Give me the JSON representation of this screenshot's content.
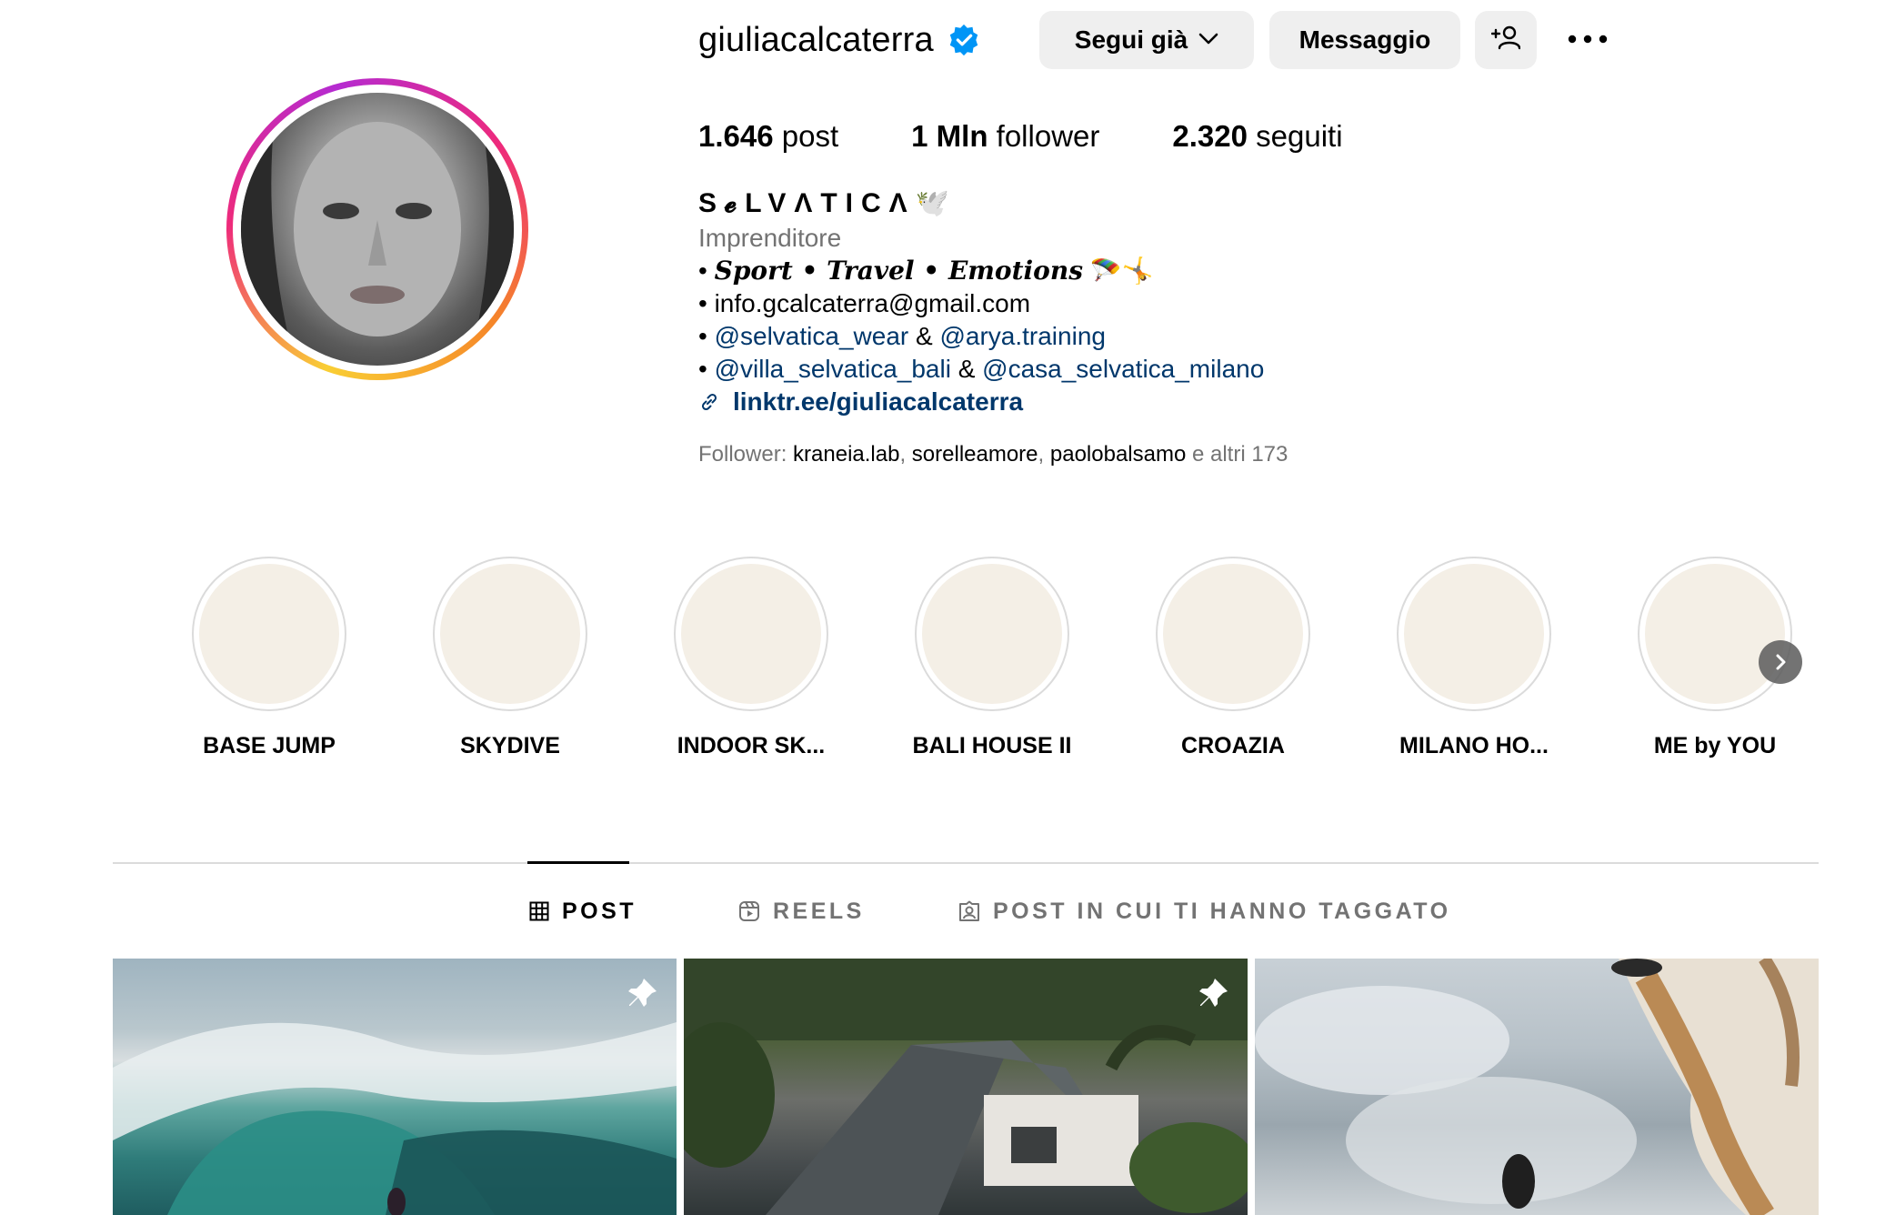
{
  "profile": {
    "username": "giuliacalcaterra",
    "verified": true,
    "buttons": {
      "follow": "Segui già",
      "message": "Messaggio"
    },
    "stats": {
      "posts_value": "1.646",
      "posts_label": "post",
      "followers_value": "1 Mln",
      "followers_label": "follower",
      "following_value": "2.320",
      "following_label": "seguiti"
    },
    "bio": {
      "name": "S𝓮LVΛTICΛ🕊️",
      "category": "Imprenditore",
      "line1_prefix": "• ",
      "line1_text": "Sport • Travel • Emotions",
      "line1_emoji": "🪂🤸",
      "line2": "• info.gcalcaterra@gmail.com",
      "line3_prefix": "• ",
      "line3_mention1": "@selvatica_wear",
      "line3_sep": " & ",
      "line3_mention2": "@arya.training",
      "line4_prefix": "• ",
      "line4_mention1": "@villa_selvatica_bali",
      "line4_sep": " & ",
      "line4_mention2": "@casa_selvatica_milano",
      "link": "linktr.ee/giuliacalcaterra"
    },
    "followed_by": {
      "label": "Follower: ",
      "users": [
        "kraneia.lab",
        "sorelleamore",
        "paolobalsamo"
      ],
      "comma": ", ",
      "suffix": " e altri 173"
    }
  },
  "highlights": [
    {
      "label": "BASE JUMP"
    },
    {
      "label": "SKYDIVE"
    },
    {
      "label": "INDOOR SK..."
    },
    {
      "label": "BALI HOUSE II"
    },
    {
      "label": "CROAZIA"
    },
    {
      "label": "MILANO HO..."
    },
    {
      "label": "ME by YOU"
    }
  ],
  "tabs": [
    {
      "label": "POST",
      "active": true
    },
    {
      "label": "REELS",
      "active": false
    },
    {
      "label": "POST IN CUI TI HANNO TAGGATO",
      "active": false
    }
  ],
  "posts": [
    {
      "pinned": true
    },
    {
      "pinned": true
    },
    {
      "pinned": false
    }
  ],
  "colors": {
    "link": "#00376b",
    "muted": "#737373",
    "button_bg": "#efefef",
    "verified": "#0095f6"
  },
  "icons": {
    "verified": "verified-badge-icon",
    "chevron": "chevron-down-icon",
    "add_user": "add-user-icon",
    "more": "more-options-icon",
    "link": "link-icon",
    "next": "chevron-right-icon",
    "grid": "grid-icon",
    "reels": "reels-icon",
    "tagged": "tagged-icon",
    "pin": "pin-icon"
  }
}
